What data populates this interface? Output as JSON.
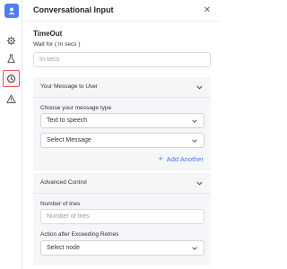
{
  "header": {
    "title": "Conversational Input",
    "close_icon": "close-icon"
  },
  "rail": {
    "items": [
      {
        "name": "bot-avatar-icon"
      },
      {
        "name": "settings-icon"
      },
      {
        "name": "flask-icon"
      },
      {
        "name": "timer-icon",
        "active": true
      },
      {
        "name": "warning-icon"
      }
    ]
  },
  "timeout": {
    "title": "TimeOut",
    "label": "Wait for ( In secs )",
    "placeholder": "In secs"
  },
  "message_card": {
    "title": "Your Message to User",
    "type_label": "Choose your message type",
    "type_value": "Text to speech",
    "message_value": "Select Message",
    "add_label": "Add Another"
  },
  "advanced_card": {
    "title": "Advanced Control",
    "tries_label": "Number of tries",
    "tries_placeholder": "Number of tries",
    "action_label": "Action after Exceeding Retries",
    "action_value": "Select node"
  },
  "colors": {
    "accent": "#3f7bf3",
    "active_border": "#e05a5a"
  }
}
